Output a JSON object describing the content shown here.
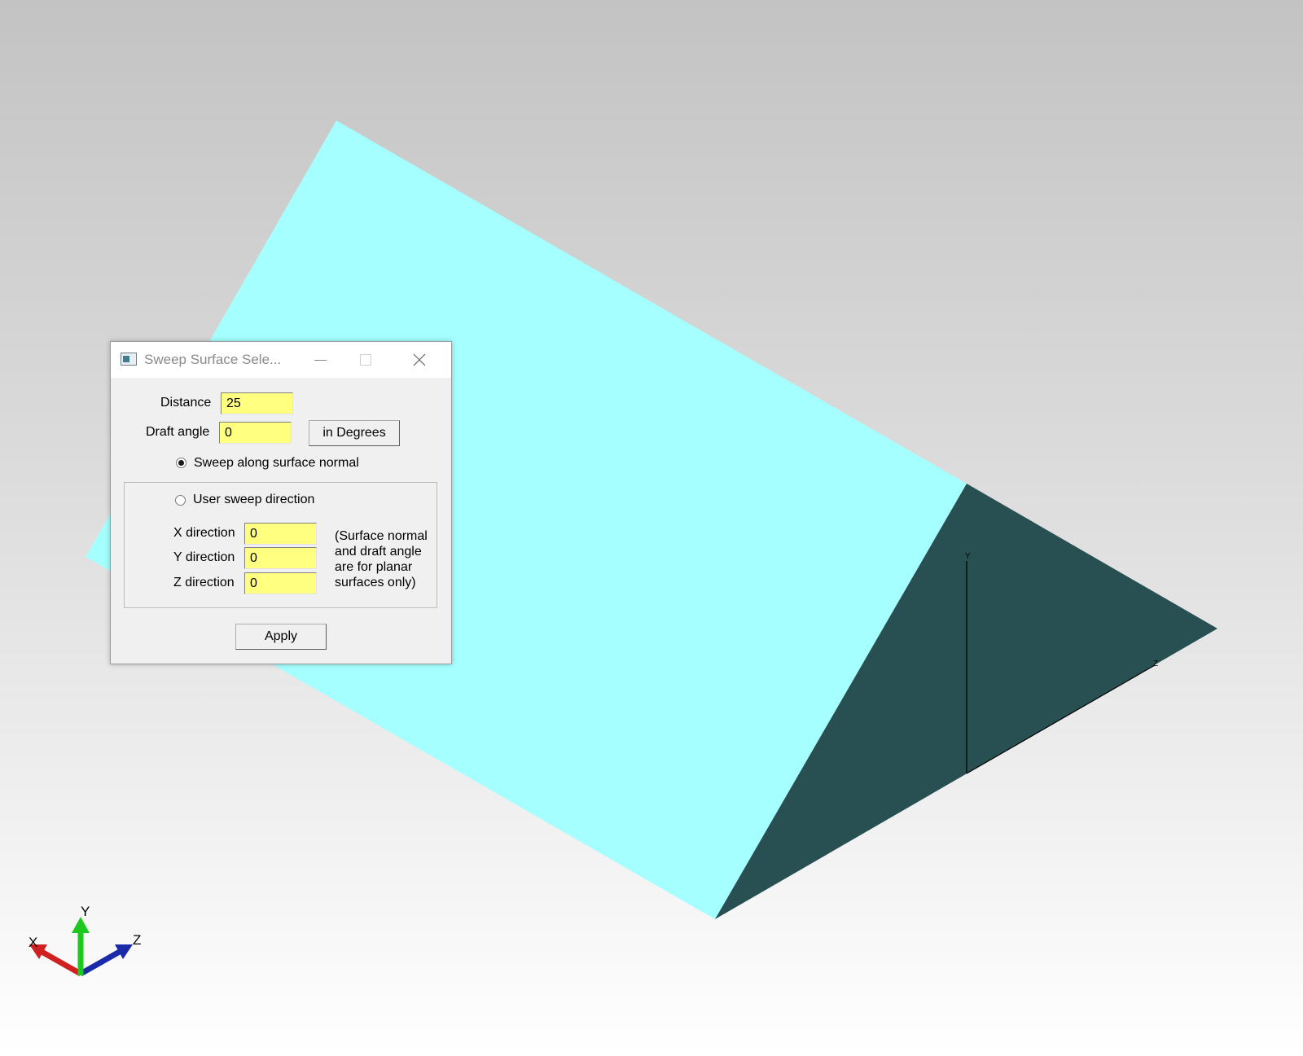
{
  "viewport": {
    "background_top": "#c3c3c3",
    "background_bottom": "#ffffff",
    "face_top_color": "#a6ffff",
    "face_side_color": "#285052",
    "local_axes": {
      "y_label": "Y",
      "z_label": "Z"
    },
    "triad": {
      "x_label": "X",
      "y_label": "Y",
      "z_label": "Z",
      "x_color": "#d02020",
      "y_color": "#1ec81e",
      "z_color": "#1a2aa8"
    }
  },
  "dialog": {
    "title": "Sweep Surface Sele...",
    "distance_label": "Distance",
    "distance_value": "25",
    "draft_angle_label": "Draft angle",
    "draft_angle_value": "0",
    "degrees_button": "in Degrees",
    "sweep_normal_label": "Sweep along surface normal",
    "sweep_normal_selected": true,
    "user_sweep_label": "User sweep direction",
    "user_sweep_selected": false,
    "x_direction_label": "X direction",
    "x_direction_value": "0",
    "y_direction_label": "Y direction",
    "y_direction_value": "0",
    "z_direction_label": "Z direction",
    "z_direction_value": "0",
    "note": "(Surface normal\nand draft angle\nare for planar\nsurfaces only)",
    "apply_button": "Apply"
  }
}
